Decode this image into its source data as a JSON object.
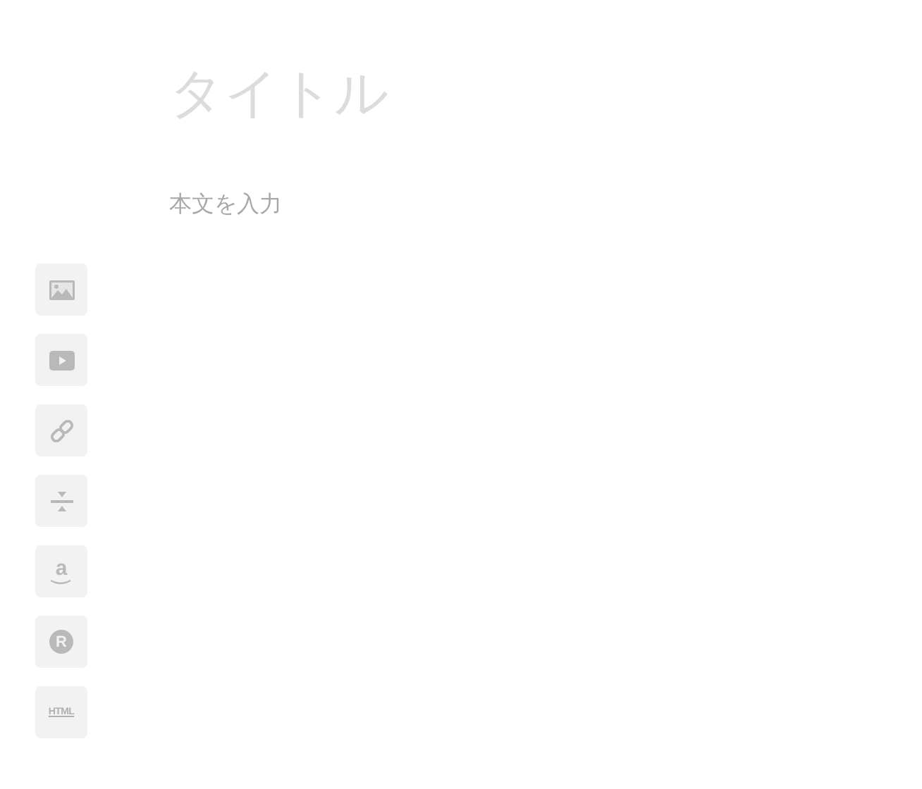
{
  "editor": {
    "title": {
      "placeholder": "タイトル"
    },
    "body": {
      "placeholder": "本文を入力"
    }
  },
  "tools": [
    {
      "kind": "image"
    },
    {
      "kind": "video"
    },
    {
      "kind": "link"
    },
    {
      "kind": "divider"
    },
    {
      "kind": "amazon",
      "glyph": "a"
    },
    {
      "kind": "rakuten",
      "glyph": "R"
    },
    {
      "kind": "html",
      "glyph": "HTML"
    }
  ]
}
